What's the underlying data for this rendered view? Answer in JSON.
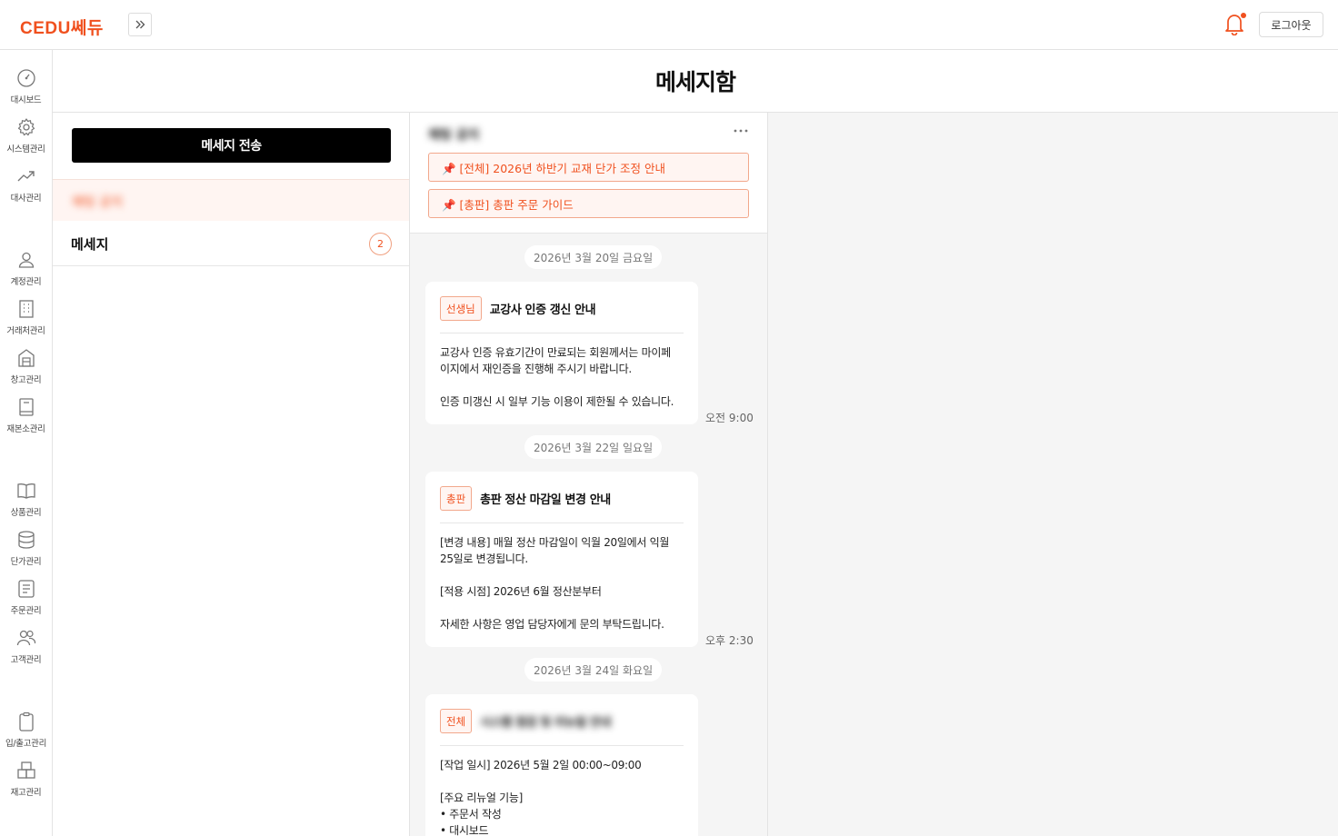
{
  "app": {
    "logo_text": "CEDU쎄듀",
    "logout_label": "로그아웃"
  },
  "colors": {
    "brand": "#f0501e",
    "pin_bg": "#fff5f2"
  },
  "icons": {
    "expand": "chevrons-right-icon",
    "bell": "bell-icon",
    "more": "more-horizontal-icon"
  },
  "sidebar": {
    "items": [
      {
        "label": "대시보드",
        "icon": "dashboard-gauge-icon"
      },
      {
        "label": "시스템관리",
        "icon": "gear-icon"
      },
      {
        "label": "대사관리",
        "icon": "trend-up-icon"
      },
      {
        "label": "계정관리",
        "icon": "user-icon"
      },
      {
        "label": "거래처관리",
        "icon": "building-icon"
      },
      {
        "label": "창고관리",
        "icon": "warehouse-icon"
      },
      {
        "label": "재본소관리",
        "icon": "book-icon"
      },
      {
        "label": "상품관리",
        "icon": "open-book-icon"
      },
      {
        "label": "단가관리",
        "icon": "database-icon"
      },
      {
        "label": "주문관리",
        "icon": "document-list-icon"
      },
      {
        "label": "고객관리",
        "icon": "users-icon"
      },
      {
        "label": "입/출고관리",
        "icon": "clipboard-icon"
      },
      {
        "label": "재고관리",
        "icon": "boxes-icon"
      }
    ]
  },
  "page": {
    "title": "메세지함"
  },
  "left": {
    "send_button": "메세지 전송",
    "active_folder": "채팅 공지",
    "folder": {
      "label": "메세지",
      "count": "2"
    }
  },
  "thread": {
    "title": "채팅 공지",
    "pinned": [
      "📌 [전체] 2026년 하반기 교재 단가 조정 안내",
      "📌 [총판] 총판 주문 가이드"
    ],
    "groups": [
      {
        "date": "2026년 3월 20일 금요일",
        "badge": "선생님",
        "title": "교강사 인증 갱신 안내",
        "body": "교강사 인증 유효기간이 만료되는 회원께서는 마이페\n이지에서 재인증을 진행해 주시기 바랍니다.\n\n인증 미갱신 시 일부 기능 이용이 제한될 수 있습니다.",
        "time": "오전 9:00"
      },
      {
        "date": "2026년 3월 22일 일요일",
        "badge": "총판",
        "title": "총판 정산 마감일 변경 안내",
        "body": "[변경 내용] 매월 정산 마감일이 익월 20일에서 익월\n25일로 변경됩니다.\n\n[적용 시점] 2026년 6월 정산분부터\n\n자세한 사항은 영업 담당자에게 문의 부탁드립니다.",
        "time": "오후 2:30"
      },
      {
        "date": "2026년 3월 24일 화요일",
        "badge": "전체",
        "title": "시스템 점검 및 리뉴얼 안내",
        "body": "[작업 일시] 2026년 5월 2일 00:00~09:00\n\n[주요 리뉴얼 기능]\n• 주문서 작성\n• 대시보드",
        "time": ""
      }
    ]
  }
}
